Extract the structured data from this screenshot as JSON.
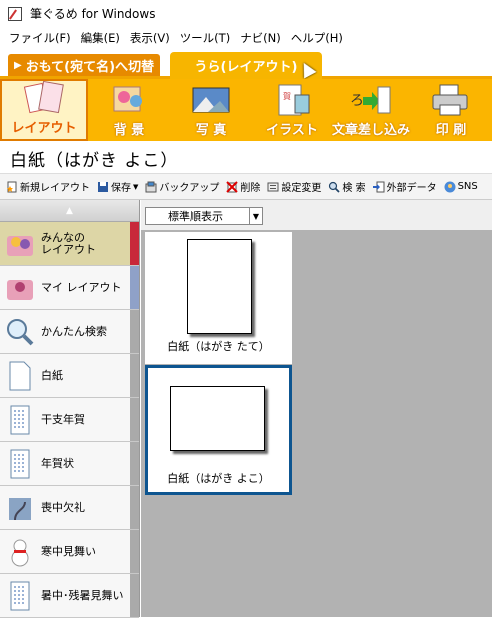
{
  "window": {
    "title": "筆ぐるめ for Windows"
  },
  "menu": [
    "ファイル(F)",
    "編集(E)",
    "表示(V)",
    "ツール(T)",
    "ナビ(N)",
    "ヘルプ(H)"
  ],
  "tabs": {
    "front": "おもて(宛て名)へ切替",
    "back": "うら(レイアウト)"
  },
  "tools": [
    {
      "label": "レイアウト",
      "icon": "layout-icon",
      "active": true
    },
    {
      "label": "背 景",
      "icon": "background-icon",
      "active": false
    },
    {
      "label": "写 真",
      "icon": "photo-icon",
      "active": false
    },
    {
      "label": "イラスト",
      "icon": "illustration-icon",
      "active": false
    },
    {
      "label": "文章差し込み",
      "icon": "text-insert-icon",
      "active": false
    },
    {
      "label": "印 刷",
      "icon": "printer-icon",
      "active": false
    }
  ],
  "page_title": "白紙（はがき よこ）",
  "actions": {
    "new_layout": "新規レイアウト",
    "save": "保存",
    "backup": "バックアップ",
    "delete": "削除",
    "settings_change": "設定変更",
    "search": "検 索",
    "external_data": "外部データ",
    "sns": "SNS"
  },
  "sidebar": [
    {
      "label": "みんなの\nレイアウト",
      "icon": "people-icon"
    },
    {
      "label": "マイ レイアウト",
      "icon": "person-icon"
    },
    {
      "label": "かんたん検索",
      "icon": "magnifier-icon"
    },
    {
      "label": "白紙",
      "icon": "blank-paper-icon"
    },
    {
      "label": "干支年賀",
      "icon": "postcard-icon"
    },
    {
      "label": "年賀状",
      "icon": "postcard-icon"
    },
    {
      "label": "喪中欠礼",
      "icon": "mourning-icon"
    },
    {
      "label": "寒中見舞い",
      "icon": "snowman-icon"
    },
    {
      "label": "暑中･残暑見舞い",
      "icon": "postcard-icon"
    }
  ],
  "sort": {
    "value": "標準順表示"
  },
  "cards": [
    {
      "caption": "白紙（はがき たて）",
      "selected": false
    },
    {
      "caption": "白紙（はがき よこ）",
      "selected": true
    }
  ]
}
